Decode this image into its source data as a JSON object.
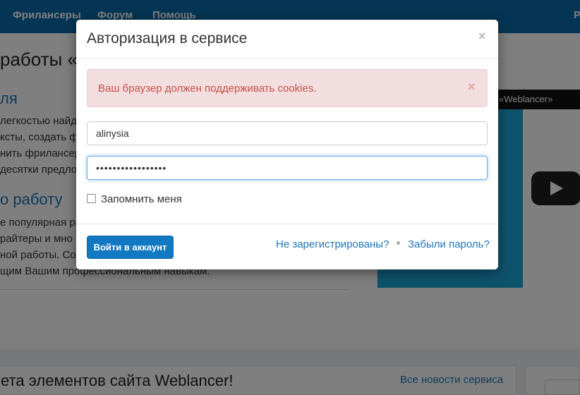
{
  "background": {
    "nav": [
      "Фрилансеры",
      "Форум",
      "Помощь",
      "Р"
    ],
    "page_title": "работы «",
    "section1_heading": "ля",
    "section1_lines": [
      "легкостью найд",
      "ксты, создать ф",
      "нить фрилансер",
      "десятки предло"
    ],
    "section2_heading": "о работу",
    "section2_lines": [
      "е популярная ра",
      "райтеры и мно",
      "ной работы. Со",
      "щим Вашим профессиональным навыкам."
    ],
    "video_label": "«Weblancer»",
    "news_title": "ета элементов сайта Weblancer!",
    "news_link": "Все новости сервиса"
  },
  "modal": {
    "title": "Авторизация в сервисе",
    "close": "×",
    "alert": {
      "text": "Ваш браузер должен поддерживать cookies.",
      "close": "×"
    },
    "login_value": "alinysia",
    "password_value": "•••••••••••••••••",
    "remember_label": "Запомнить меня",
    "submit_label": "Войти в аккаунт",
    "register_link": "Не зарегистрированы?",
    "forgot_link": "Забыли пароль?"
  },
  "colors": {
    "nav_bg": "#0b6aa8",
    "primary_button": "#1179c2",
    "link": "#1d75b8",
    "alert_bg": "#f2dede",
    "alert_text": "#c7504b",
    "focus_border": "#66afe9"
  }
}
